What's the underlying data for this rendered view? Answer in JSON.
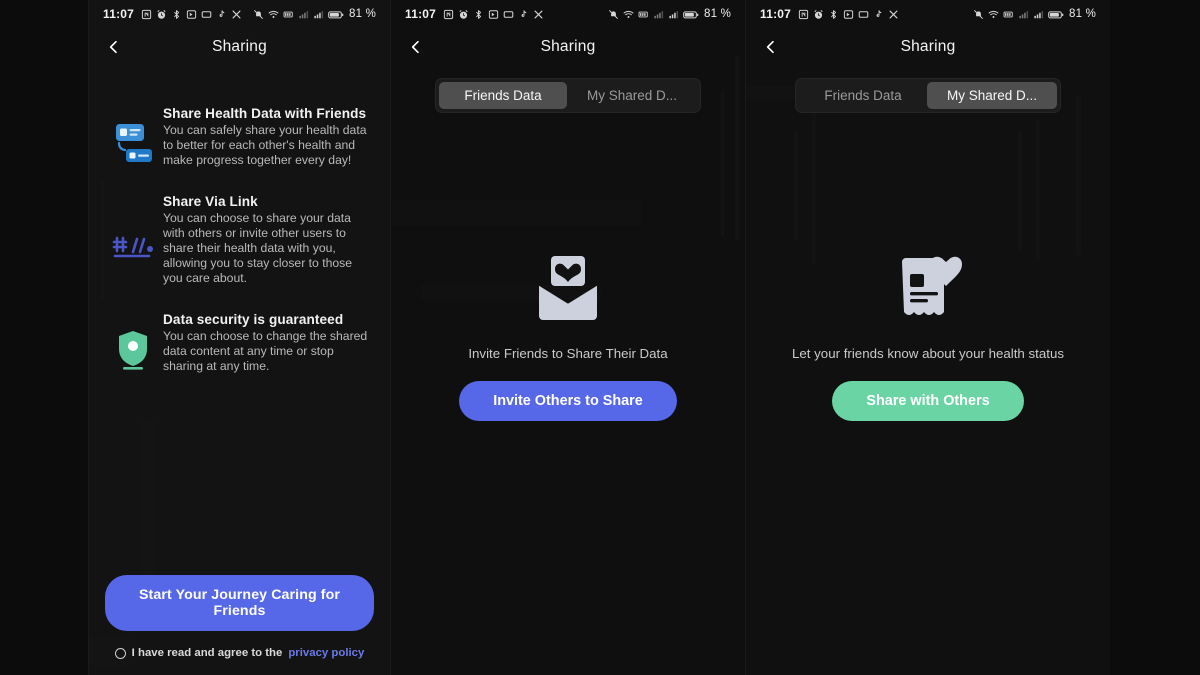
{
  "colors": {
    "background": "#0d0d0d",
    "panel": "#121212",
    "accent_blue": "#5667e8",
    "accent_green": "#6ad4a4",
    "link": "#6b7ae8",
    "tab_active": "#4f4f4f",
    "tab_track": "#1c1c1c"
  },
  "status_bar": {
    "time": "11:07",
    "battery_percent": "81 %",
    "left_icons": [
      "nfc-icon",
      "alarm-icon",
      "bluetooth-icon",
      "screen-record-icon",
      "cast-icon",
      "tiktok-icon",
      "x-icon"
    ],
    "right_icons": [
      "mute-icon",
      "wifi-icon",
      "vpn-icon",
      "signal-1-icon",
      "signal-2-icon",
      "battery-icon"
    ]
  },
  "nav": {
    "title": "Sharing",
    "back_icon": "chevron-left-icon"
  },
  "panel1": {
    "features": [
      {
        "icon": "share-cards-icon",
        "title": "Share Health Data with Friends",
        "desc": "You can safely share your health data to better for each other's health and make progress together every day!"
      },
      {
        "icon": "hash-link-icon",
        "title": "Share Via Link",
        "desc": "You can choose to share your data with others or invite other users to share their health data with you, allowing you to stay closer to those you care about."
      },
      {
        "icon": "shield-icon",
        "title": "Data security is guaranteed",
        "desc": "You can choose to change the shared data content at any time or stop sharing at any time."
      }
    ],
    "cta_label": "Start Your Journey Caring for Friends",
    "agree_text": "I have read and agree to the",
    "agree_link": "privacy policy",
    "agree_checked": false
  },
  "panel2": {
    "tabs": [
      {
        "label": "Friends Data",
        "active": true
      },
      {
        "label": "My Shared D...",
        "active": false
      }
    ],
    "empty_icon": "mail-heart-icon",
    "caption": "Invite Friends to Share Their Data",
    "cta_label": "Invite Others to Share"
  },
  "panel3": {
    "tabs": [
      {
        "label": "Friends Data",
        "active": false
      },
      {
        "label": "My Shared D...",
        "active": true
      }
    ],
    "empty_icon": "card-heart-icon",
    "caption": "Let your friends know about your health status",
    "cta_label": "Share with Others"
  }
}
